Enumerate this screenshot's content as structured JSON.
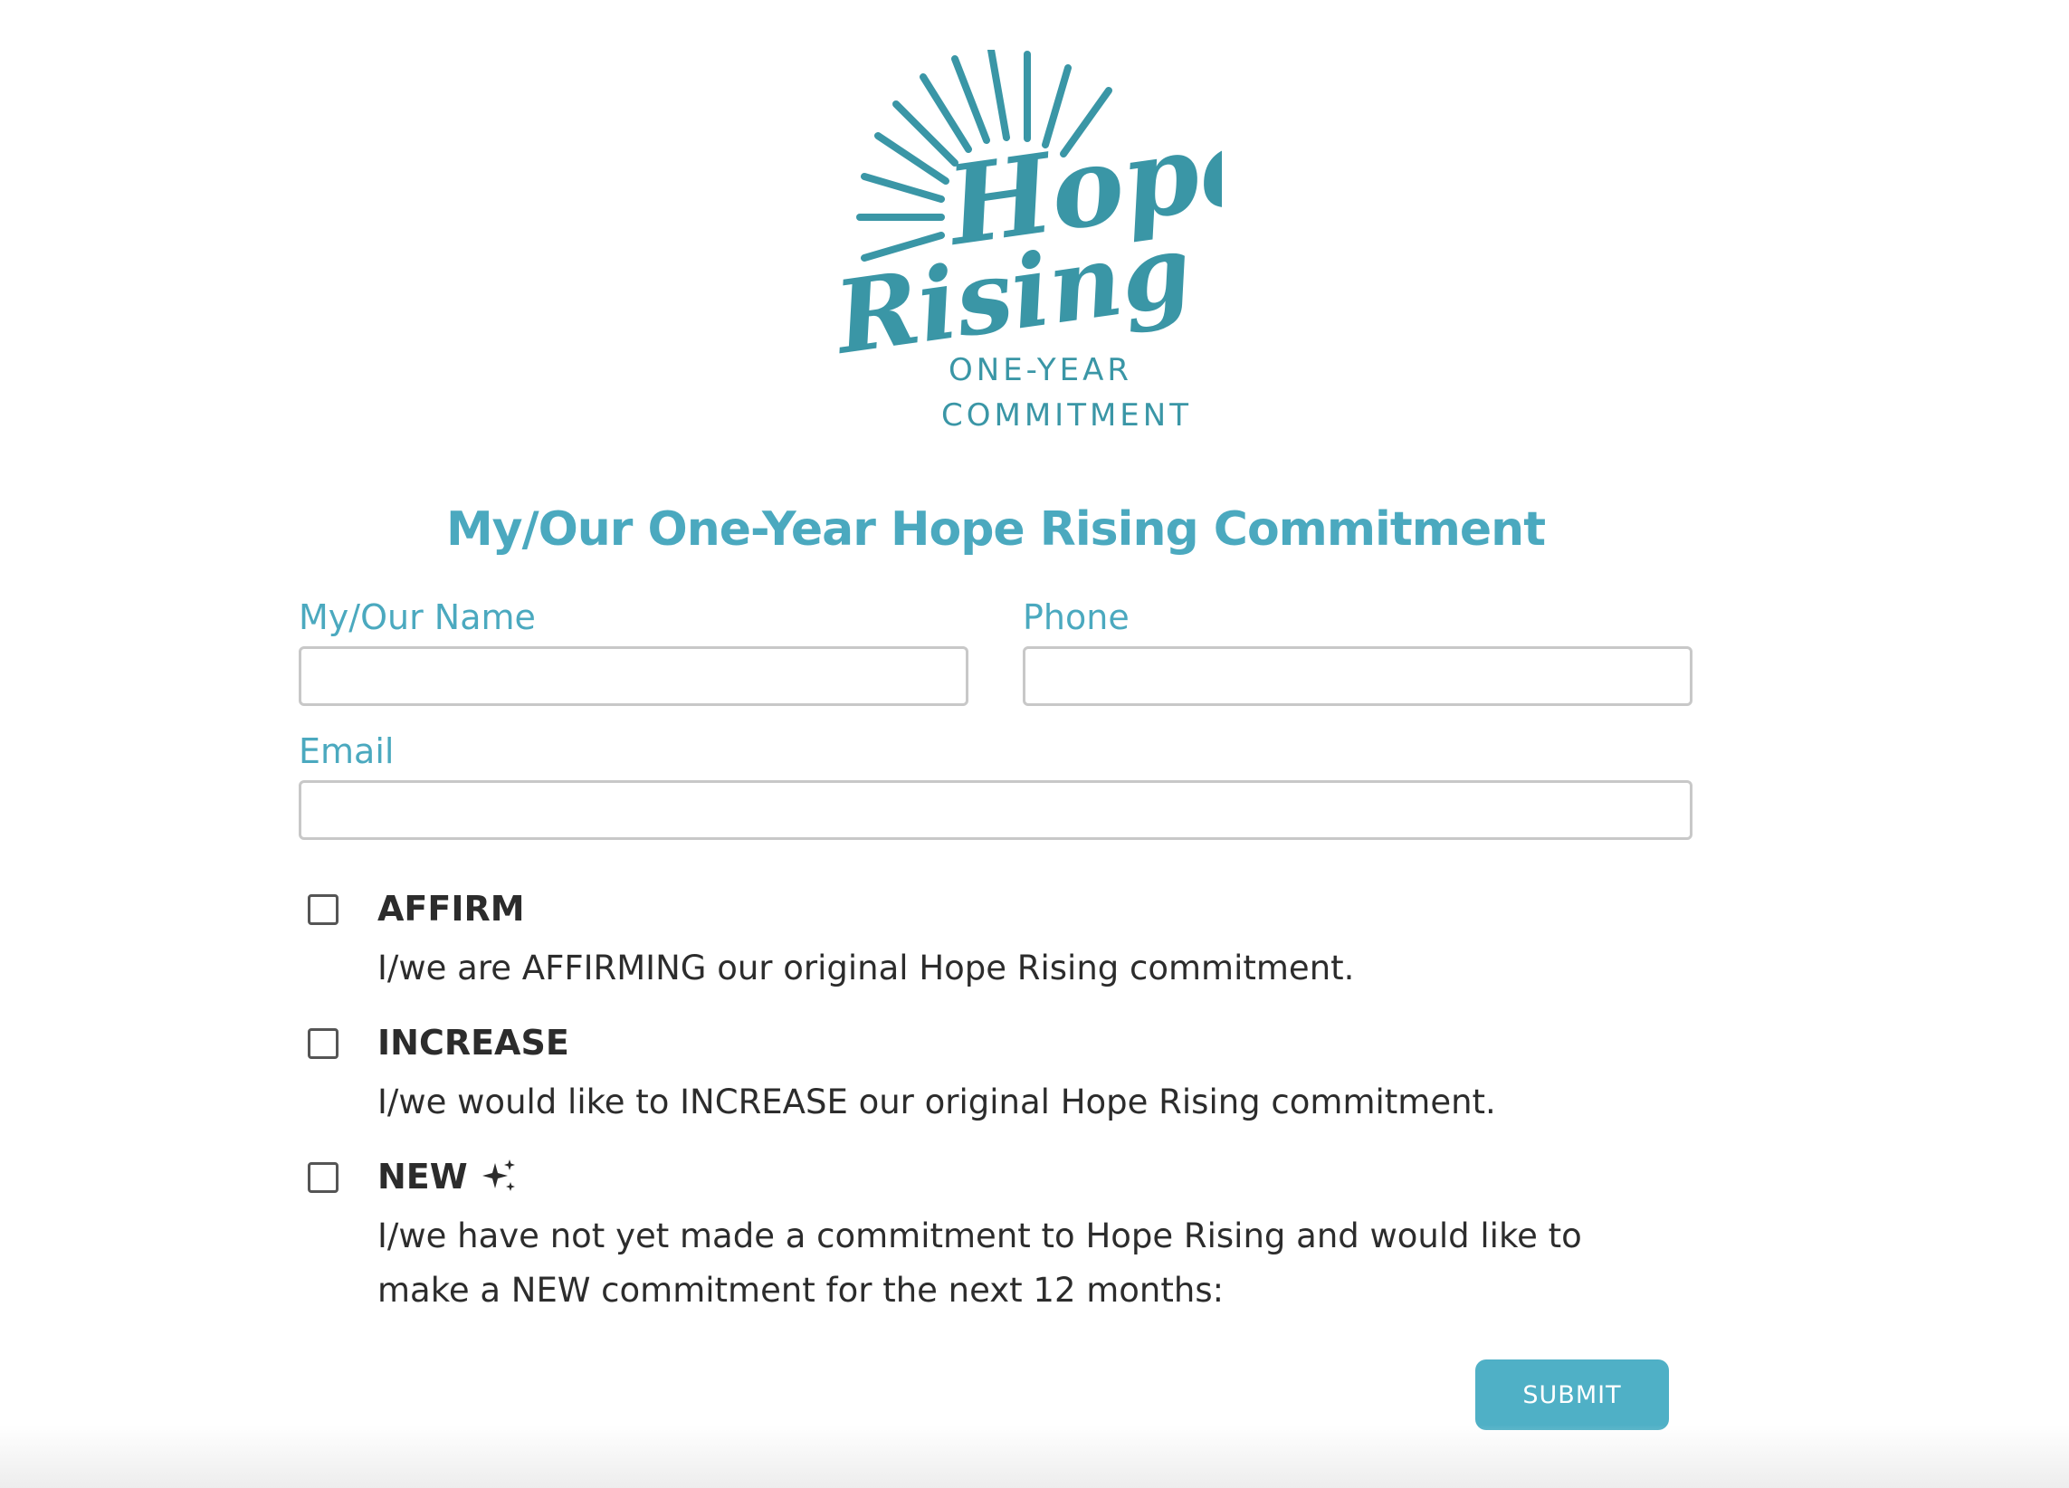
{
  "colors": {
    "brand_teal": "#3a96a6",
    "label_teal": "#4ba9bf",
    "button_teal": "#4fb0c6",
    "text_dark": "#2c2c2c",
    "input_border": "#c8c8c8"
  },
  "logo": {
    "line1": "Hope",
    "line2": "Rising",
    "tagline1": "ONE-YEAR",
    "tagline2": "COMMITMENT"
  },
  "form": {
    "title": "My/Our One-Year Hope Rising Commitment",
    "name": {
      "label": "My/Our Name",
      "value": ""
    },
    "phone": {
      "label": "Phone",
      "value": ""
    },
    "email": {
      "label": "Email",
      "value": ""
    },
    "options": [
      {
        "title": "AFFIRM",
        "description": "I/we are AFFIRMING our original Hope Rising commitment.",
        "checked": false
      },
      {
        "title": "INCREASE",
        "description": "I/we would like to INCREASE our original Hope Rising commitment.",
        "checked": false
      },
      {
        "title": "NEW",
        "icon": "sparkle-icon",
        "description": "I/we have not yet made a commitment to Hope Rising and would like to make a NEW commitment for the next 12 months:",
        "checked": false
      }
    ],
    "submit_label": "SUBMIT"
  }
}
